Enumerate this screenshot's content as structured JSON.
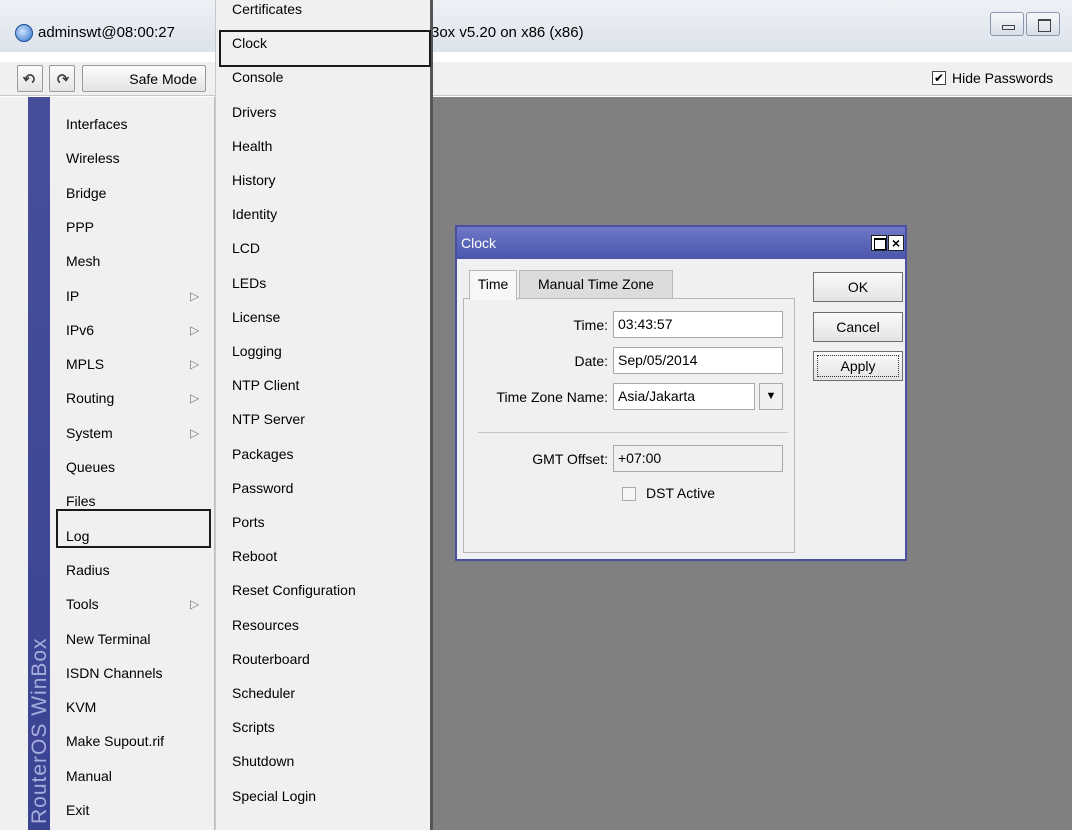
{
  "window": {
    "title_left": "adminswt@08:00:27",
    "title_right": "3ox v5.20 on x86 (x86)"
  },
  "toolbar": {
    "undo_icon": "undo-icon",
    "redo_icon": "redo-icon",
    "safe_mode": "Safe Mode",
    "hide_passwords": "Hide Passwords",
    "hide_passwords_checked": true
  },
  "brand": "RouterOS WinBox",
  "left_menu": [
    {
      "label": "Interfaces",
      "arrow": false
    },
    {
      "label": "Wireless",
      "arrow": false
    },
    {
      "label": "Bridge",
      "arrow": false
    },
    {
      "label": "PPP",
      "arrow": false
    },
    {
      "label": "Mesh",
      "arrow": false
    },
    {
      "label": "IP",
      "arrow": true
    },
    {
      "label": "IPv6",
      "arrow": true
    },
    {
      "label": "MPLS",
      "arrow": true
    },
    {
      "label": "Routing",
      "arrow": true
    },
    {
      "label": "System",
      "arrow": true
    },
    {
      "label": "Queues",
      "arrow": false
    },
    {
      "label": "Files",
      "arrow": false
    },
    {
      "label": "Log",
      "arrow": false
    },
    {
      "label": "Radius",
      "arrow": false
    },
    {
      "label": "Tools",
      "arrow": true
    },
    {
      "label": "New Terminal",
      "arrow": false
    },
    {
      "label": "ISDN Channels",
      "arrow": false
    },
    {
      "label": "KVM",
      "arrow": false
    },
    {
      "label": "Make Supout.rif",
      "arrow": false
    },
    {
      "label": "Manual",
      "arrow": false
    },
    {
      "label": "Exit",
      "arrow": false
    }
  ],
  "system_submenu": [
    "Certificates",
    "Clock",
    "Console",
    "Drivers",
    "Health",
    "History",
    "Identity",
    "LCD",
    "LEDs",
    "License",
    "Logging",
    "NTP Client",
    "NTP Server",
    "Packages",
    "Password",
    "Ports",
    "Reboot",
    "Reset Configuration",
    "Resources",
    "Routerboard",
    "Scheduler",
    "Scripts",
    "Shutdown",
    "Special Login"
  ],
  "clock_dialog": {
    "title": "Clock",
    "tabs": [
      "Time",
      "Manual Time Zone"
    ],
    "time_label": "Time:",
    "time_value": "03:43:57",
    "date_label": "Date:",
    "date_value": "Sep/05/2014",
    "tz_label": "Time Zone Name:",
    "tz_value": "Asia/Jakarta",
    "gmt_label": "GMT Offset:",
    "gmt_value": "+07:00",
    "dst_label": "DST Active",
    "dst_checked": false,
    "ok": "OK",
    "cancel": "Cancel",
    "apply": "Apply"
  }
}
